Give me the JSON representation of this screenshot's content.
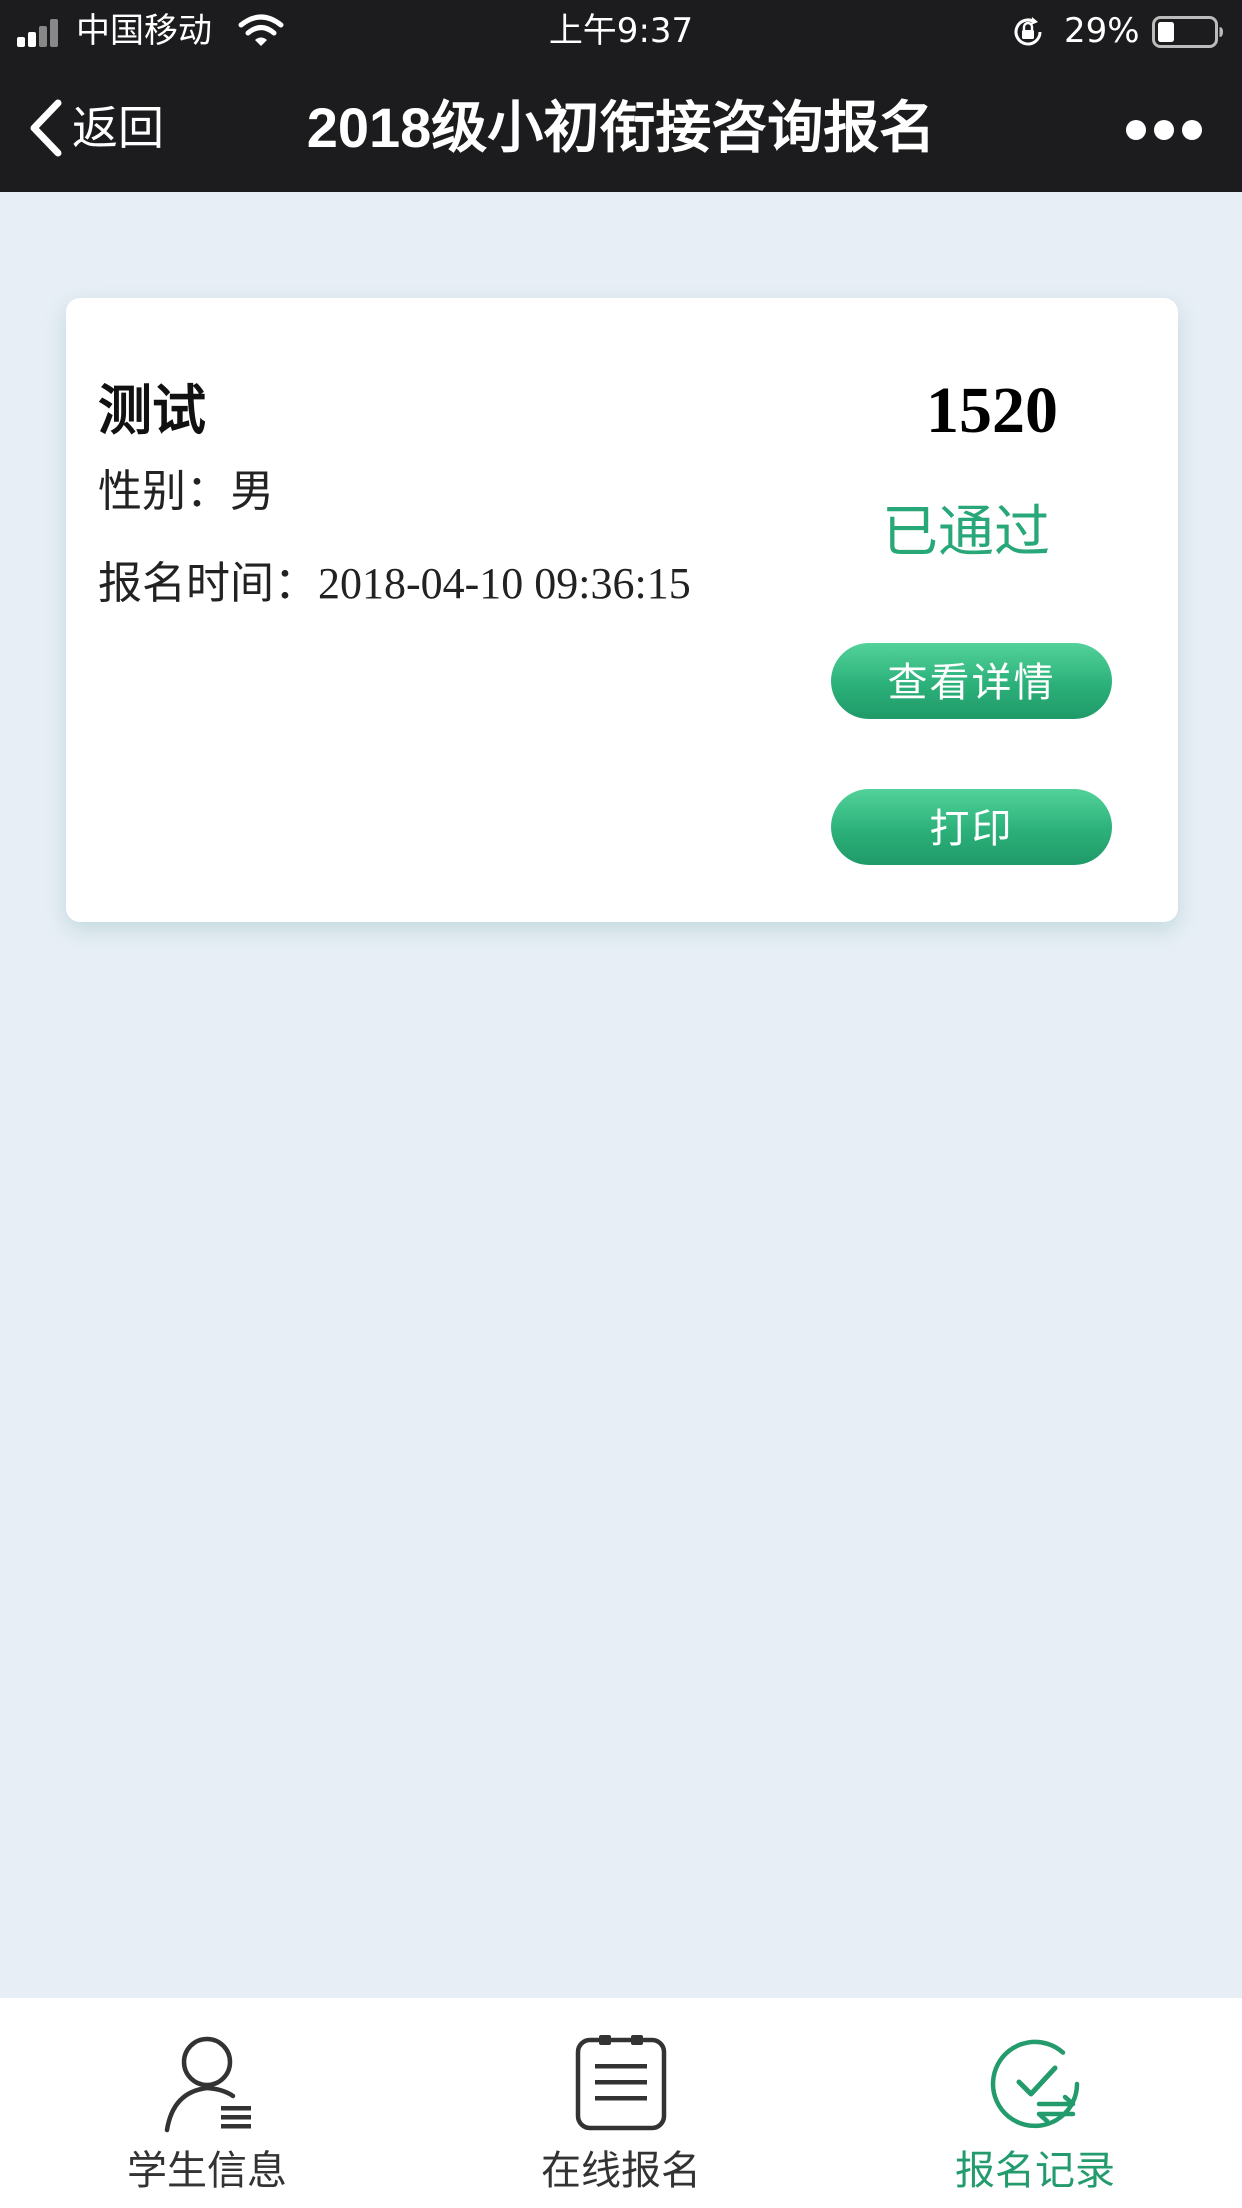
{
  "status_bar": {
    "carrier": "中国移动",
    "time": "上午9:37",
    "battery_percent": "29%",
    "battery_level": 0.29
  },
  "nav": {
    "back_label": "返回",
    "title": "2018级小初衔接咨询报名"
  },
  "record": {
    "name": "测试",
    "number": "1520",
    "gender_label": "性别：",
    "gender": "男",
    "time_label": "报名时间：",
    "time": "2018-04-10 09:36:15",
    "status": "已通过",
    "detail_button": "查看详情",
    "print_button": "打印"
  },
  "tabs": [
    {
      "label": "学生信息",
      "icon": "user-icon",
      "active": false
    },
    {
      "label": "在线报名",
      "icon": "clipboard-icon",
      "active": false
    },
    {
      "label": "报名记录",
      "icon": "check-record-icon",
      "active": true
    }
  ],
  "colors": {
    "accent": "#28a878",
    "nav_background": "#1c1c1e",
    "page_background": "#e7eef6"
  }
}
